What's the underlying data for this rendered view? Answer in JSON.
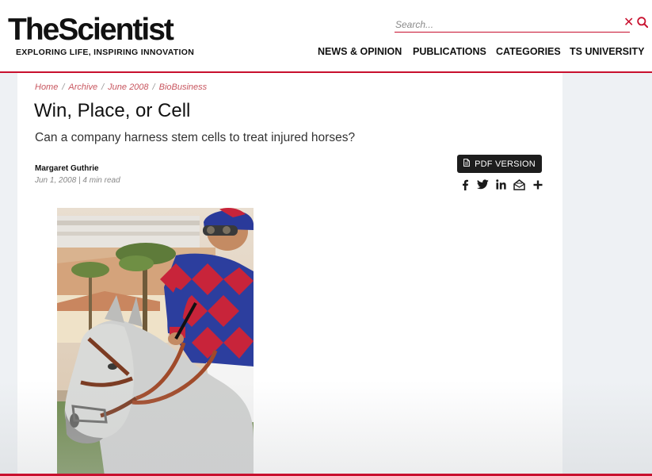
{
  "brand": {
    "logo": "TheScientist",
    "tagline": "EXPLORING LIFE, INSPIRING INNOVATION",
    "accent_color": "#c8102e"
  },
  "search": {
    "placeholder": "Search...",
    "value": ""
  },
  "nav": {
    "items": [
      {
        "label": "NEWS & OPINION"
      },
      {
        "label": "PUBLICATIONS"
      },
      {
        "label": "CATEGORIES"
      },
      {
        "label": "TS UNIVERSITY"
      }
    ]
  },
  "breadcrumb": [
    "Home",
    "Archive",
    "June 2008",
    "BioBusiness"
  ],
  "article": {
    "title": "Win, Place, or Cell",
    "subtitle": "Can a company harness stem cells to treat injured horses?",
    "author": "Margaret Guthrie",
    "date_readtime": "Jun 1, 2008 | 4 min read",
    "pdf_label": "PDF VERSION",
    "share_icons": [
      "facebook-icon",
      "twitter-icon",
      "linkedin-icon",
      "email-icon",
      "plus-icon"
    ],
    "image_alt": "Jockey in red and blue silks riding a grey horse"
  }
}
